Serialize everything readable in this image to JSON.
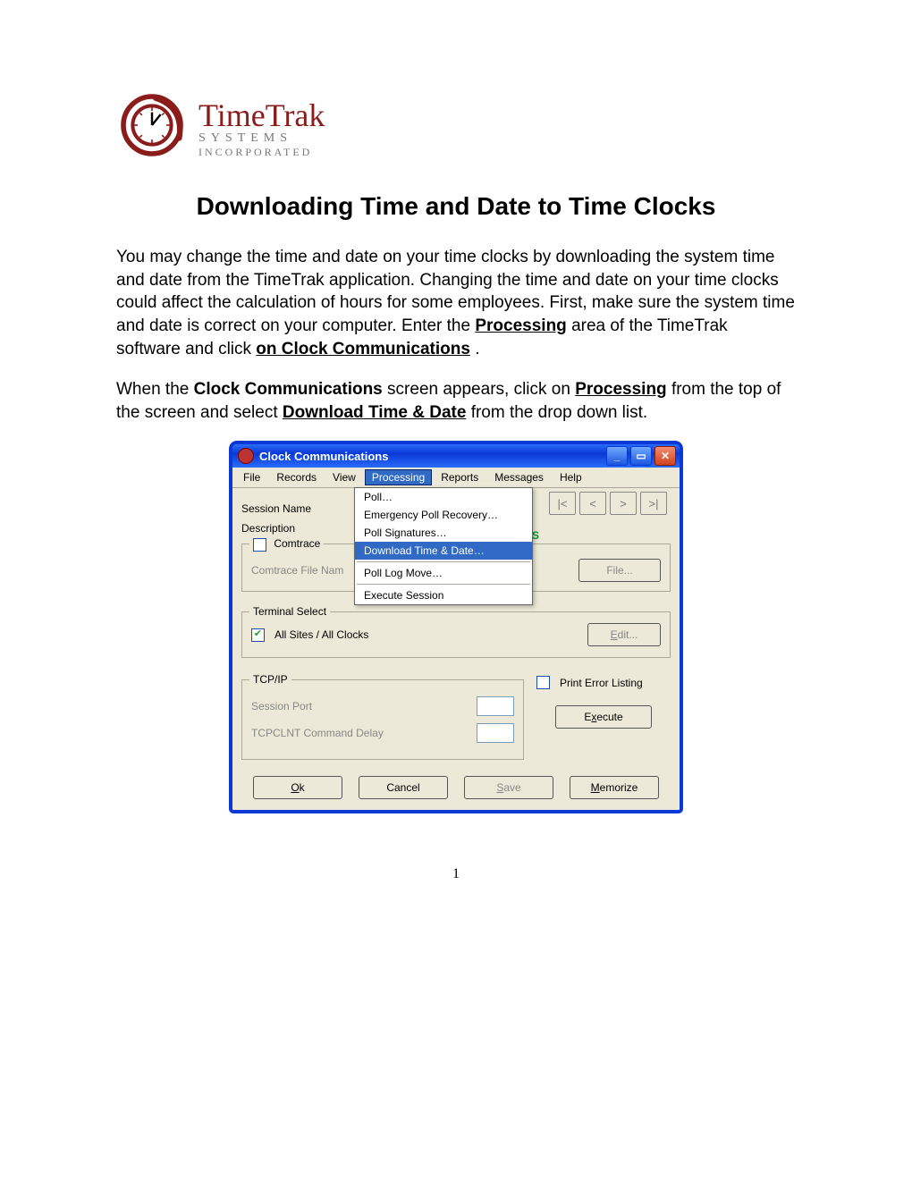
{
  "brand": {
    "name": "TimeTrak",
    "sub1": "SYSTEMS",
    "sub2": "INCORPORATED"
  },
  "title": "Downloading Time and Date to Time Clocks",
  "para1": {
    "t1": "You may change the time and date on your time clocks by downloading the system time and date from the TimeTrak application.  Changing the time and date on your time clocks could affect the calculation of hours for some employees.  First, make sure the system time and date is correct on your computer.  Enter the ",
    "b1": "Processing",
    "t2": " area of the TimeTrak software and click ",
    "b2": "on Clock Communications",
    "t3": "."
  },
  "para2": {
    "t1": "When the ",
    "b1": "Clock Communications",
    "t2": " screen appears, click on ",
    "bu1": "Processing",
    "t3": " from the top of the screen and select ",
    "bu2": "Download Time & Date",
    "t4": " from the drop down list."
  },
  "window": {
    "title": "Clock Communications",
    "menus": [
      "File",
      "Records",
      "View",
      "Processing",
      "Reports",
      "Messages",
      "Help"
    ],
    "dropdown": [
      "Poll…",
      "Emergency Poll Recovery…",
      "Poll Signatures…",
      "Download Time & Date…",
      "Poll Log Move…",
      "Execute Session"
    ],
    "nav": [
      "|<",
      "<",
      ">",
      ">|"
    ],
    "labels": {
      "session": "Session Name",
      "desc": "Description",
      "comtrace": "Comtrace",
      "comtraceFile": "Comtrace File Nam",
      "fileBtn": "File...",
      "termSel": "Terminal Select",
      "allSites": "All Sites / All Clocks",
      "edit": "Edit...",
      "tcpip": "TCP/IP",
      "sessionPort": "Session Port",
      "tcpDelay": "TCPCLNT Command Delay",
      "printErr": "Print Error Listing",
      "execute": "Execute",
      "strayS": "S"
    },
    "buttons": {
      "ok": "Ok",
      "cancel": "Cancel",
      "save": "Save",
      "memorize": "Memorize"
    }
  },
  "pageNumber": "1"
}
